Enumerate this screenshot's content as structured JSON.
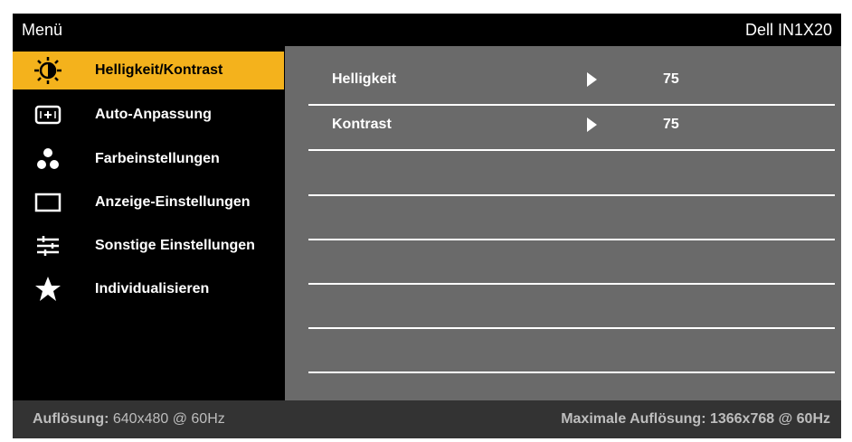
{
  "header": {
    "title": "Menü",
    "model": "Dell IN1X20"
  },
  "sidebar": {
    "items": [
      {
        "label": "Helligkeit/Kontrast",
        "icon": "brightness-icon",
        "selected": true
      },
      {
        "label": "Auto-Anpassung",
        "icon": "auto-adjust-icon",
        "selected": false
      },
      {
        "label": "Farbeinstellungen",
        "icon": "color-dots-icon",
        "selected": false
      },
      {
        "label": "Anzeige-Einstellungen",
        "icon": "display-icon",
        "selected": false
      },
      {
        "label": "Sonstige Einstellungen",
        "icon": "sliders-icon",
        "selected": false
      },
      {
        "label": "Individualisieren",
        "icon": "star-icon",
        "selected": false
      }
    ]
  },
  "content": {
    "rows": [
      {
        "name": "Helligkeit",
        "value": "75"
      },
      {
        "name": "Kontrast",
        "value": "75"
      }
    ]
  },
  "footer": {
    "resolution_label": "Auflösung:",
    "resolution_value": "640x480 @ 60Hz",
    "max_resolution": "Maximale Auflösung: 1366x768 @ 60Hz"
  },
  "colors": {
    "accent": "#f4b21c",
    "panel": "#6a6a6a",
    "footer": "#333333"
  }
}
